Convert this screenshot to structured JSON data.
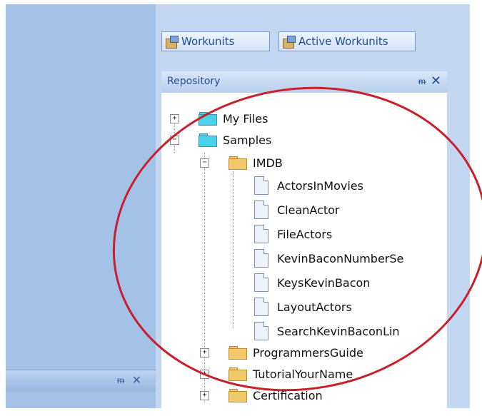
{
  "tabs": [
    {
      "label": "Workunits",
      "icon": "workunit-icon"
    },
    {
      "label": "Active Workunits",
      "icon": "active-workunit-icon"
    }
  ],
  "repository": {
    "title": "Repository",
    "pin_glyph": "ᵯ",
    "close_glyph": "✕"
  },
  "left_panel": {
    "pin_glyph": "ᵯ",
    "close_glyph": "✕"
  },
  "tree": {
    "my_files": "My Files",
    "samples": "Samples",
    "imdb": "IMDB",
    "files": [
      "ActorsInMovies",
      "CleanActor",
      "FileActors",
      "KevinBaconNumberSe",
      "KeysKevinBacon",
      "LayoutActors",
      "SearchKevinBaconLin"
    ],
    "programmers_guide": "ProgrammersGuide",
    "tutorial": "TutorialYourName",
    "certification": "Certification"
  },
  "colors": {
    "accent_blue": "#1f4d9a",
    "left_panel": "#a4c1e8",
    "annotation_circle": "#c8202a"
  }
}
